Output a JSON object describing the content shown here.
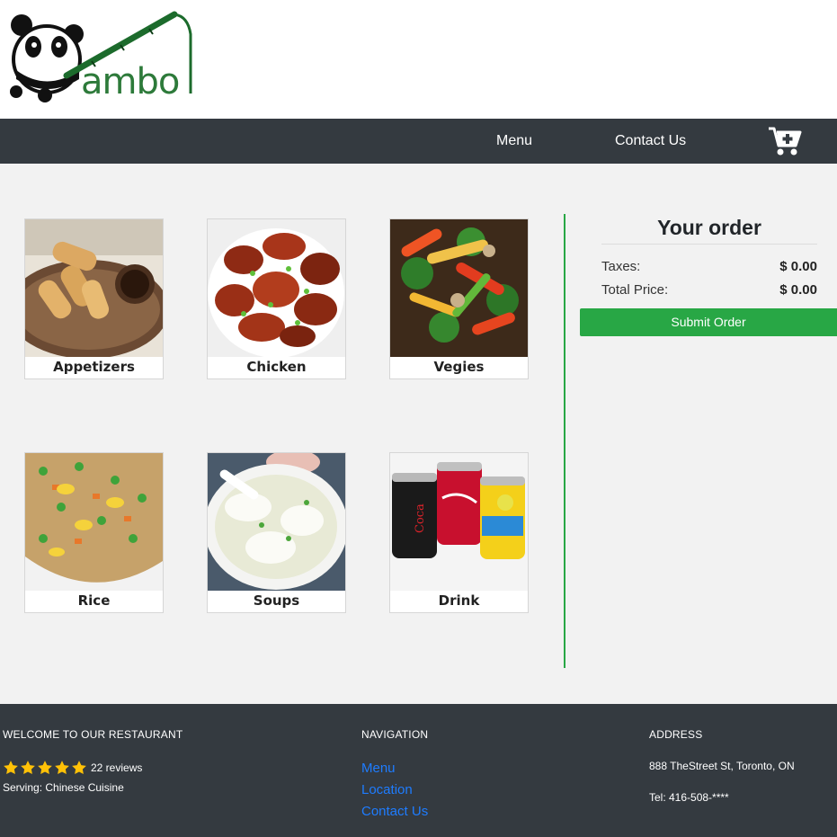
{
  "brand": {
    "logo_text": "ambo",
    "logo_alt": "Bamboo panda logo"
  },
  "nav": {
    "menu_label": "Menu",
    "contact_label": "Contact Us",
    "cart_icon": "cart-plus-icon"
  },
  "categories": [
    {
      "label": "Appetizers"
    },
    {
      "label": "Chicken"
    },
    {
      "label": "Vegies"
    },
    {
      "label": "Rice"
    },
    {
      "label": "Soups"
    },
    {
      "label": "Drink"
    }
  ],
  "order": {
    "title": "Your order",
    "taxes_label": "Taxes:",
    "taxes_value": "$ 0.00",
    "total_label": "Total Price:",
    "total_value": "$ 0.00",
    "submit_label": "Submit Order"
  },
  "footer": {
    "welcome": {
      "heading": "WELCOME TO OUR RESTAURANT",
      "stars": 5,
      "reviews": "22 reviews",
      "serving": "Serving: Chinese Cuisine"
    },
    "navigation": {
      "heading": "NAVIGATION",
      "links": [
        "Menu",
        "Location",
        "Contact Us"
      ]
    },
    "address": {
      "heading": "ADDRESS",
      "street": "888 TheStreet St, Toronto, ON",
      "tel": "Tel: 416-508-****"
    }
  },
  "colors": {
    "navbar": "#343a40",
    "accent_green": "#28a745",
    "link_blue": "#1e7cff",
    "star_yellow": "#ffc107",
    "background": "#f2f2f2"
  }
}
